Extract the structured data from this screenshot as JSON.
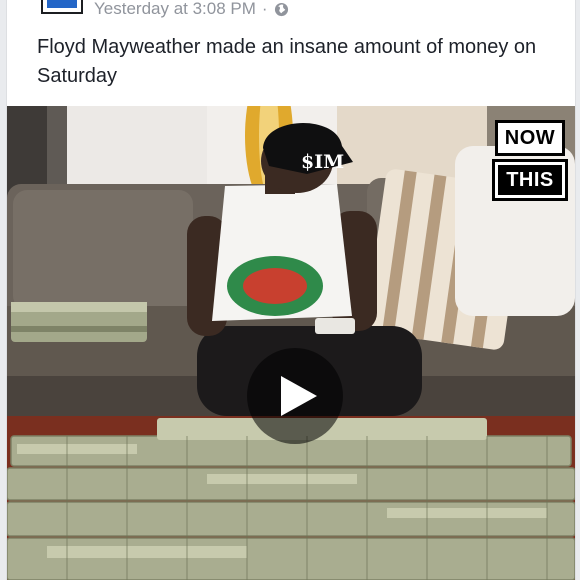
{
  "post": {
    "timestamp": "Yesterday at 3:08 PM",
    "separator": "·",
    "privacy_icon": "globe-icon",
    "text": "Floyd Mayweather made an insane amount of money on Saturday"
  },
  "video": {
    "brand_line1": "NOW",
    "brand_line2": "THIS",
    "cap_text": "$IM",
    "play_icon": "play-icon"
  },
  "colors": {
    "meta_text": "#90949c",
    "body_text": "#1d2129",
    "money_green": "#9aa07e"
  }
}
